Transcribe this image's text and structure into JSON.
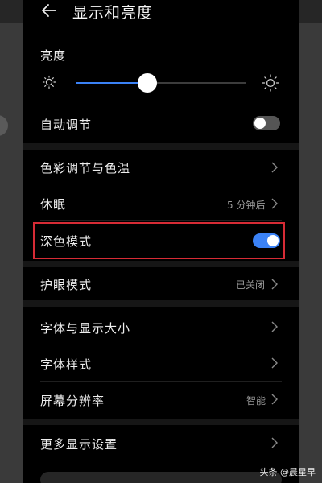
{
  "header": {
    "title": "显示和亮度"
  },
  "brightness": {
    "label": "亮度",
    "level": 0.42
  },
  "auto_adjust": {
    "label": "自动调节",
    "enabled": false
  },
  "color_temp": {
    "label": "色彩调节与色温"
  },
  "sleep": {
    "label": "休眠",
    "value": "5 分钟后"
  },
  "dark_mode": {
    "label": "深色模式",
    "enabled": true
  },
  "eye_comfort": {
    "label": "护眼模式",
    "value": "已关闭"
  },
  "font_size": {
    "label": "字体与显示大小"
  },
  "font_style": {
    "label": "字体样式"
  },
  "resolution": {
    "label": "屏幕分辨率",
    "value": "智能"
  },
  "more": {
    "label": "更多显示设置"
  },
  "watermark": {
    "text": "头条 @晨星早"
  },
  "colors": {
    "accent": "#3b82f6",
    "highlight": "#d62b35",
    "toggle_off": "#555555"
  }
}
